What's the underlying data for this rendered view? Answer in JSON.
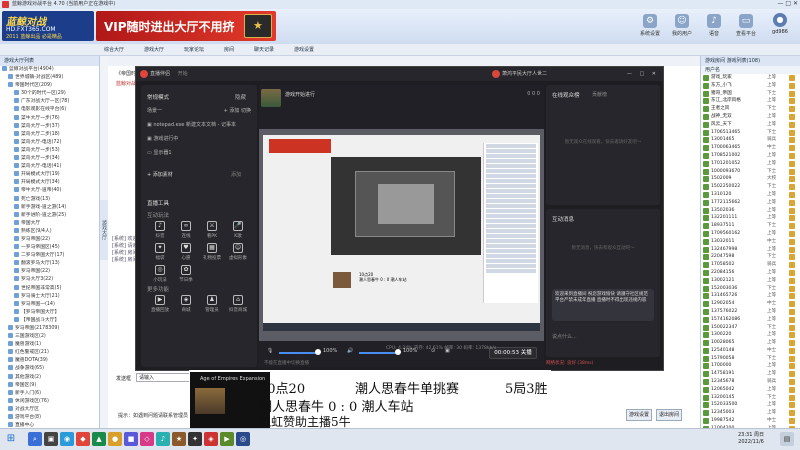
{
  "host": {
    "title": "蓝鲸游戏对战平台 4.70 (当前用户正在游戏中)",
    "logo_line1": "蓝鲸对战",
    "logo_line2": "HD.FXT365.COM",
    "logo_line3": "2011 蓝鲸出品 必是精品",
    "vip_text": "VIP随时进出大厅不用挤",
    "actions": [
      {
        "icon": "gear-icon",
        "label": "系统设置"
      },
      {
        "icon": "user-icon",
        "label": "我的用户"
      },
      {
        "icon": "notify-icon",
        "label": "语音"
      },
      {
        "icon": "monitor-icon",
        "label": "查看平台"
      }
    ],
    "username": "gd986",
    "room_tabs": [
      "综合大厅",
      "游戏大厅",
      "玩家论坛",
      "房间",
      "聊天记录",
      "游戏设置"
    ],
    "left_title": "游戏大厅列表",
    "side_handle": "游戏大厅",
    "tree": [
      {
        "label": "蓝鲸对战平台(4904)",
        "level": 0
      },
      {
        "label": "世界城镇-对战区(489)",
        "level": 1
      },
      {
        "label": "帝国时代区(209)",
        "level": 1
      },
      {
        "label": "30个的时代一区(29)",
        "level": 2
      },
      {
        "label": "广东对战大厅一区(78)",
        "level": 2
      },
      {
        "label": "电影观影在线平台(6)",
        "level": 2
      },
      {
        "label": "菜牛大厅一步(76)",
        "level": 2
      },
      {
        "label": "菜鸟大厅一步(37)",
        "level": 2
      },
      {
        "label": "菜鸟大厅二步(18)",
        "level": 2
      },
      {
        "label": "菜鸟大厅-电话(72)",
        "level": 2
      },
      {
        "label": "菜鸟大厅一步(53)",
        "level": 2
      },
      {
        "label": "菜鸟大厅一步(34)",
        "level": 2
      },
      {
        "label": "菜鸟大厅-电话(41)",
        "level": 2
      },
      {
        "label": "开局模式大厅(19)",
        "level": 2
      },
      {
        "label": "开局模式大厅(34)",
        "level": 2
      },
      {
        "label": "帝牛大厅-道帝(40)",
        "level": 2
      },
      {
        "label": "死亡游戏(13)",
        "level": 2
      },
      {
        "label": "新手游戏-道之游(14)",
        "level": 2
      },
      {
        "label": "新手进阶-道之游(25)",
        "level": 2
      },
      {
        "label": "帝国大厅",
        "level": 2
      },
      {
        "label": "熟练区(9/4人)",
        "level": 2
      },
      {
        "label": "罗马帝国(22)",
        "level": 2
      },
      {
        "label": "一罗马帝国区(45)",
        "level": 2
      },
      {
        "label": "二罗马帝国大厅(17)",
        "level": 2
      },
      {
        "label": "翻滚罗马大厅(13)",
        "level": 2
      },
      {
        "label": "罗马帝国(22)",
        "level": 2
      },
      {
        "label": "罗马大厅3(22)",
        "level": 2
      },
      {
        "label": "世纪帝国非常高(5)",
        "level": 2
      },
      {
        "label": "罗马骑士大厅(21)",
        "level": 2
      },
      {
        "label": "罗马帝国一(14)",
        "level": 2
      },
      {
        "label": "【罗马帝国大厅】",
        "level": 2
      },
      {
        "label": "【帝国战斗大厅】",
        "level": 2
      },
      {
        "label": "罗马帝国(2178309)",
        "level": 1
      },
      {
        "label": "三国游戏区(2)",
        "level": 1
      },
      {
        "label": "魔兽游戏(1)",
        "level": 1
      },
      {
        "label": "红色警戒区(21)",
        "level": 1
      },
      {
        "label": "魔兽DOTA(39)",
        "level": 1
      },
      {
        "label": "战争游戏(65)",
        "level": 1
      },
      {
        "label": "其他游戏(2)",
        "level": 1
      },
      {
        "label": "帝国区(9)",
        "level": 1
      },
      {
        "label": "新手入门(6)",
        "level": 1
      },
      {
        "label": "休闲游戏区(76)",
        "level": 1
      },
      {
        "label": "对战大厅区",
        "level": 1
      },
      {
        "label": "游戏平台(8)",
        "level": 1
      },
      {
        "label": "直播中心",
        "level": 1
      }
    ],
    "mid_note": "《帝国时代》的游戏大厅",
    "mid_note2": "蓝鲸对战平台提示：请文明游戏",
    "chat_lines": [
      "[系统] 欢迎来到帝国时代大厅",
      "[系统] 请遵守平台规则",
      "[系统] 房间内禁止恶意刷屏",
      "[系统] 房间已开启直播"
    ],
    "say_label": "发送框",
    "say_value": "请输入",
    "send_label": "发送",
    "tip_text": "提示：如遇到问题请联系管理员",
    "bottom_buttons": [
      "游戏设置",
      "退出房间"
    ],
    "right_tabs": "游戏房间  游戏列表(108)",
    "right_head": "用户名",
    "users": [
      {
        "name": "游戏_玩家",
        "rank": "上等"
      },
      {
        "name": "东方_小飞",
        "rank": "上等"
      },
      {
        "name": "猪哥_帝国",
        "rank": "下士"
      },
      {
        "name": "东江_北岸风格",
        "rank": "上等"
      },
      {
        "name": "王者之风",
        "rank": "下士"
      },
      {
        "name": "战神_无双",
        "rank": "上等"
      },
      {
        "name": "风云_天下",
        "rank": "上等"
      },
      {
        "name": "1706513465",
        "rank": "下士"
      },
      {
        "name": "13001465",
        "rank": "骑兵"
      },
      {
        "name": "1700063465",
        "rank": "中士"
      },
      {
        "name": "1708521002",
        "rank": "上等"
      },
      {
        "name": "1701201052",
        "rank": "上等"
      },
      {
        "name": "1000093670",
        "rank": "下士"
      },
      {
        "name": "1502009",
        "rank": "大校"
      },
      {
        "name": "1502250022",
        "rank": "下士"
      },
      {
        "name": "1310120",
        "rank": "上等"
      },
      {
        "name": "1772115662",
        "rank": "上等"
      },
      {
        "name": "13502036",
        "rank": "上等"
      },
      {
        "name": "132201111",
        "rank": "上等"
      },
      {
        "name": "18937511",
        "rank": "下士"
      },
      {
        "name": "1709560162",
        "rank": "上等"
      },
      {
        "name": "13032011",
        "rank": "中士"
      },
      {
        "name": "132467998",
        "rank": "上等"
      },
      {
        "name": "22047598",
        "rank": "下士"
      },
      {
        "name": "17058502",
        "rank": "骑兵"
      },
      {
        "name": "22084156",
        "rank": "上等"
      },
      {
        "name": "13002121",
        "rank": "上等"
      },
      {
        "name": "152003036",
        "rank": "下士"
      },
      {
        "name": "131465726",
        "rank": "上等"
      },
      {
        "name": "12902054",
        "rank": "中士"
      },
      {
        "name": "137576022",
        "rank": "上等"
      },
      {
        "name": "1574162086",
        "rank": "上等"
      },
      {
        "name": "150022347",
        "rank": "下士"
      },
      {
        "name": "1300220",
        "rank": "上等"
      },
      {
        "name": "10028065",
        "rank": "上等"
      },
      {
        "name": "12540148",
        "rank": "中士"
      },
      {
        "name": "15790058",
        "rank": "下士"
      },
      {
        "name": "1700000",
        "rank": "上等"
      },
      {
        "name": "14758191",
        "rank": "上等"
      },
      {
        "name": "12345678",
        "rank": "骑兵"
      },
      {
        "name": "12065042",
        "rank": "上等"
      },
      {
        "name": "13200145",
        "rank": "下士"
      },
      {
        "name": "152033500",
        "rank": "上等"
      },
      {
        "name": "12345003",
        "rank": "上等"
      },
      {
        "name": "19987542",
        "rank": "中士"
      },
      {
        "name": "11004200",
        "rank": "上等"
      }
    ]
  },
  "stream": {
    "app_title": "直播伴侣",
    "app_sub": "开始",
    "username": "萧鸿平民大厅人世二",
    "window_controls": "— □ ✕",
    "mode_label": "常规模式",
    "mode_right": "隐藏",
    "scene_label": "场景一",
    "scene_actions": "+ 添加 切换",
    "source_1": "notepad.exe 新建文本文档 - 记事本",
    "source_2": "游戏进行中",
    "source_3": "显示器1",
    "add_source": "+ 添加素材",
    "add_source_right": "添加",
    "tools_title": "直播工具",
    "interact_title": "互动玩法",
    "tools": [
      {
        "label": "抖音",
        "icon": "♪"
      },
      {
        "label": "连线",
        "icon": "∞"
      },
      {
        "label": "看PK",
        "icon": "⚔"
      },
      {
        "label": "K歌",
        "icon": "🎤"
      },
      {
        "label": "福袋",
        "icon": "✦"
      },
      {
        "label": "心愿",
        "icon": "♥"
      },
      {
        "label": "礼物投票",
        "icon": "▦"
      },
      {
        "label": "虚拟形象",
        "icon": "☺"
      },
      {
        "label": "小玩法",
        "icon": "◎"
      },
      {
        "label": "节日季",
        "icon": "✿"
      }
    ],
    "more_title": "更多功能",
    "more_tools": [
      {
        "label": "直播回放",
        "icon": "▶"
      },
      {
        "label": "商城",
        "icon": "◈"
      },
      {
        "label": "管理员",
        "icon": "♟"
      },
      {
        "label": "抖音商城",
        "icon": "⌂"
      }
    ],
    "game_name": "游戏开始进行",
    "stats": "0  0  0",
    "audio_pct_1": "100%",
    "audio_pct_2": "100%",
    "timer": "00:00:53 关播",
    "online_title": "在线观众榜",
    "online_sub": "贡献榜",
    "online_empty": "暂无观众在线观看，快去邀请好友吧～",
    "interact_msg_title": "互动消息",
    "interact_empty": "暂无消息，快去和观众互动吧～",
    "message": "欢迎来到直播间 祝您游戏愉快 请遵守社区规范 平台严禁未成年直播 直播时不得出现违规内容",
    "chat_placeholder": "说点什么...",
    "cpu": "CPU: 4.24%  内存: 42.61%  帧率: 30  码率: 1378kb/s",
    "warn": "不能在直播中切换直播",
    "network": "网络状况: 良好 (38ms)"
  },
  "overlay": {
    "thumb_title": "Age of Empires Expansion",
    "line1_time": "10点20",
    "line1_event": "潮人思春牛单挑赛",
    "line1_format": "5局3胜",
    "line2": "潮人思春牛  0 : 0  潮人车站",
    "line3": "飘虹赞助主播5牛"
  },
  "taskbar": {
    "start": "⊞",
    "apps": [
      "⌕",
      "▣",
      "◉",
      "◆",
      "▲",
      "●",
      "■",
      "◇",
      "♪",
      "★",
      "✦",
      "◈",
      "▶",
      "◎"
    ],
    "time": "23:31 周日",
    "date": "2022/11/6"
  }
}
